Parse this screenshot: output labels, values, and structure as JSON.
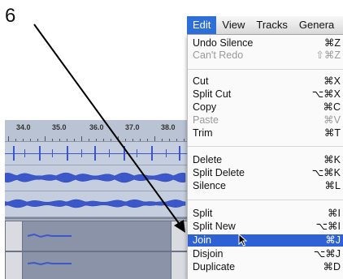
{
  "step_number": "6",
  "colors": {
    "highlight": "#2e62d4",
    "waveform": "#3b57c9"
  },
  "ruler": {
    "labels": [
      "34.0",
      "35.0",
      "36.0",
      "37.0",
      "38.0"
    ]
  },
  "menubar": {
    "items": [
      {
        "label": "Edit",
        "active": true
      },
      {
        "label": "View"
      },
      {
        "label": "Tracks"
      },
      {
        "label": "Genera"
      }
    ]
  },
  "edit_menu": {
    "groups": [
      [
        {
          "label": "Undo Silence",
          "shortcut": "⌘Z"
        },
        {
          "label": "Can't Redo",
          "shortcut": "⇧⌘Z",
          "disabled": true
        }
      ],
      [
        {
          "label": "Cut",
          "shortcut": "⌘X"
        },
        {
          "label": "Split Cut",
          "shortcut": "⌥⌘X"
        },
        {
          "label": "Copy",
          "shortcut": "⌘C"
        },
        {
          "label": "Paste",
          "shortcut": "⌘V",
          "disabled": true
        },
        {
          "label": "Trim",
          "shortcut": "⌘T"
        }
      ],
      [
        {
          "label": "Delete",
          "shortcut": "⌘K"
        },
        {
          "label": "Split Delete",
          "shortcut": "⌥⌘K"
        },
        {
          "label": "Silence",
          "shortcut": "⌘L"
        }
      ],
      [
        {
          "label": "Split",
          "shortcut": "⌘I"
        },
        {
          "label": "Split New",
          "shortcut": "⌥⌘I"
        },
        {
          "label": "Join",
          "shortcut": "⌘J",
          "selected": true
        },
        {
          "label": "Disjoin",
          "shortcut": "⌥⌘J"
        },
        {
          "label": "Duplicate",
          "shortcut": "⌘D"
        }
      ]
    ]
  }
}
